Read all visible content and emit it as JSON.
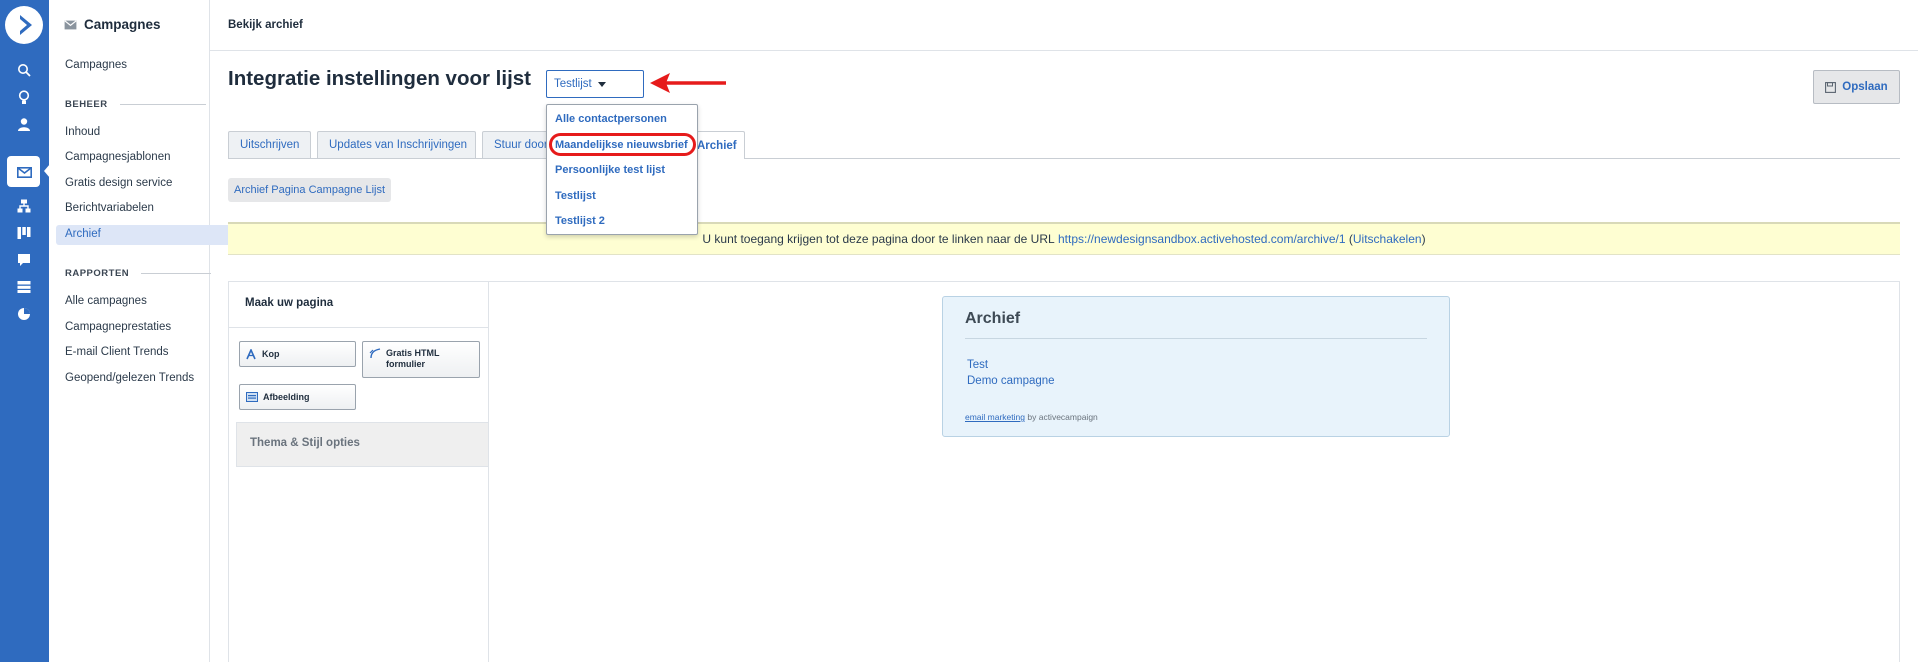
{
  "colors": {
    "brand": "#2f6bbf",
    "highlight": "#e61b1b",
    "notice_bg": "#fefed2"
  },
  "rail": {
    "icons": [
      "logo-icon",
      "search-icon",
      "lightbulb-icon",
      "contacts-icon",
      "campaigns-icon",
      "automation-icon",
      "deals-icon",
      "conversations-icon",
      "sites-icon",
      "reports-icon"
    ]
  },
  "subnav": {
    "title": "Campagnes",
    "items": [
      {
        "label": "Campagnes"
      }
    ],
    "section_beheer": "BEHEER",
    "beheer_items": [
      {
        "label": "Inhoud"
      },
      {
        "label": "Campagnesjablonen"
      },
      {
        "label": "Gratis design service"
      },
      {
        "label": "Berichtvariabelen"
      },
      {
        "label": "Archief"
      }
    ],
    "section_rapporten": "RAPPORTEN",
    "rapporten_items": [
      {
        "label": "Alle campagnes"
      },
      {
        "label": "Campagneprestaties"
      },
      {
        "label": "E-mail Client Trends"
      },
      {
        "label": "Geopend/gelezen Trends"
      }
    ]
  },
  "topbar": {
    "title": "Bekijk archief"
  },
  "main": {
    "title": "Integratie instellingen voor lijst",
    "list_select": {
      "value": "Testlijst"
    },
    "save_label": "Opslaan",
    "tabs": [
      {
        "label": "Uitschrijven"
      },
      {
        "label": "Updates van Inschrijvingen"
      },
      {
        "label": "Stuur door"
      },
      {
        "label": "Archief"
      }
    ],
    "pill": "Archief Pagina Campagne Lijst",
    "notice": {
      "text": "U kunt toegang krijgen tot deze pagina door te linken naar de URL",
      "url": "https://newdesignsandbox.activehosted.com/archive/1",
      "open_paren": "(",
      "disable": "Uitschakelen",
      "close_paren": ")"
    }
  },
  "dropdown": {
    "options": [
      {
        "label": "Alle contactpersonen"
      },
      {
        "label": "Maandelijkse nieuwsbrief"
      },
      {
        "label": "Persoonlijke test lijst"
      },
      {
        "label": "Testlijst"
      },
      {
        "label": "Testlijst 2"
      }
    ]
  },
  "builder": {
    "heading": "Maak uw pagina",
    "widgets": [
      {
        "label": "Kop"
      },
      {
        "label": "Gratis HTML formulier"
      },
      {
        "label": "Afbeelding"
      }
    ],
    "theme": "Thema & Stijl opties"
  },
  "archive": {
    "title": "Archief",
    "links": [
      {
        "label": "Test"
      },
      {
        "label": "Demo campagne"
      }
    ],
    "footer_link": "email marketing",
    "footer_text": "by activecampaign"
  }
}
